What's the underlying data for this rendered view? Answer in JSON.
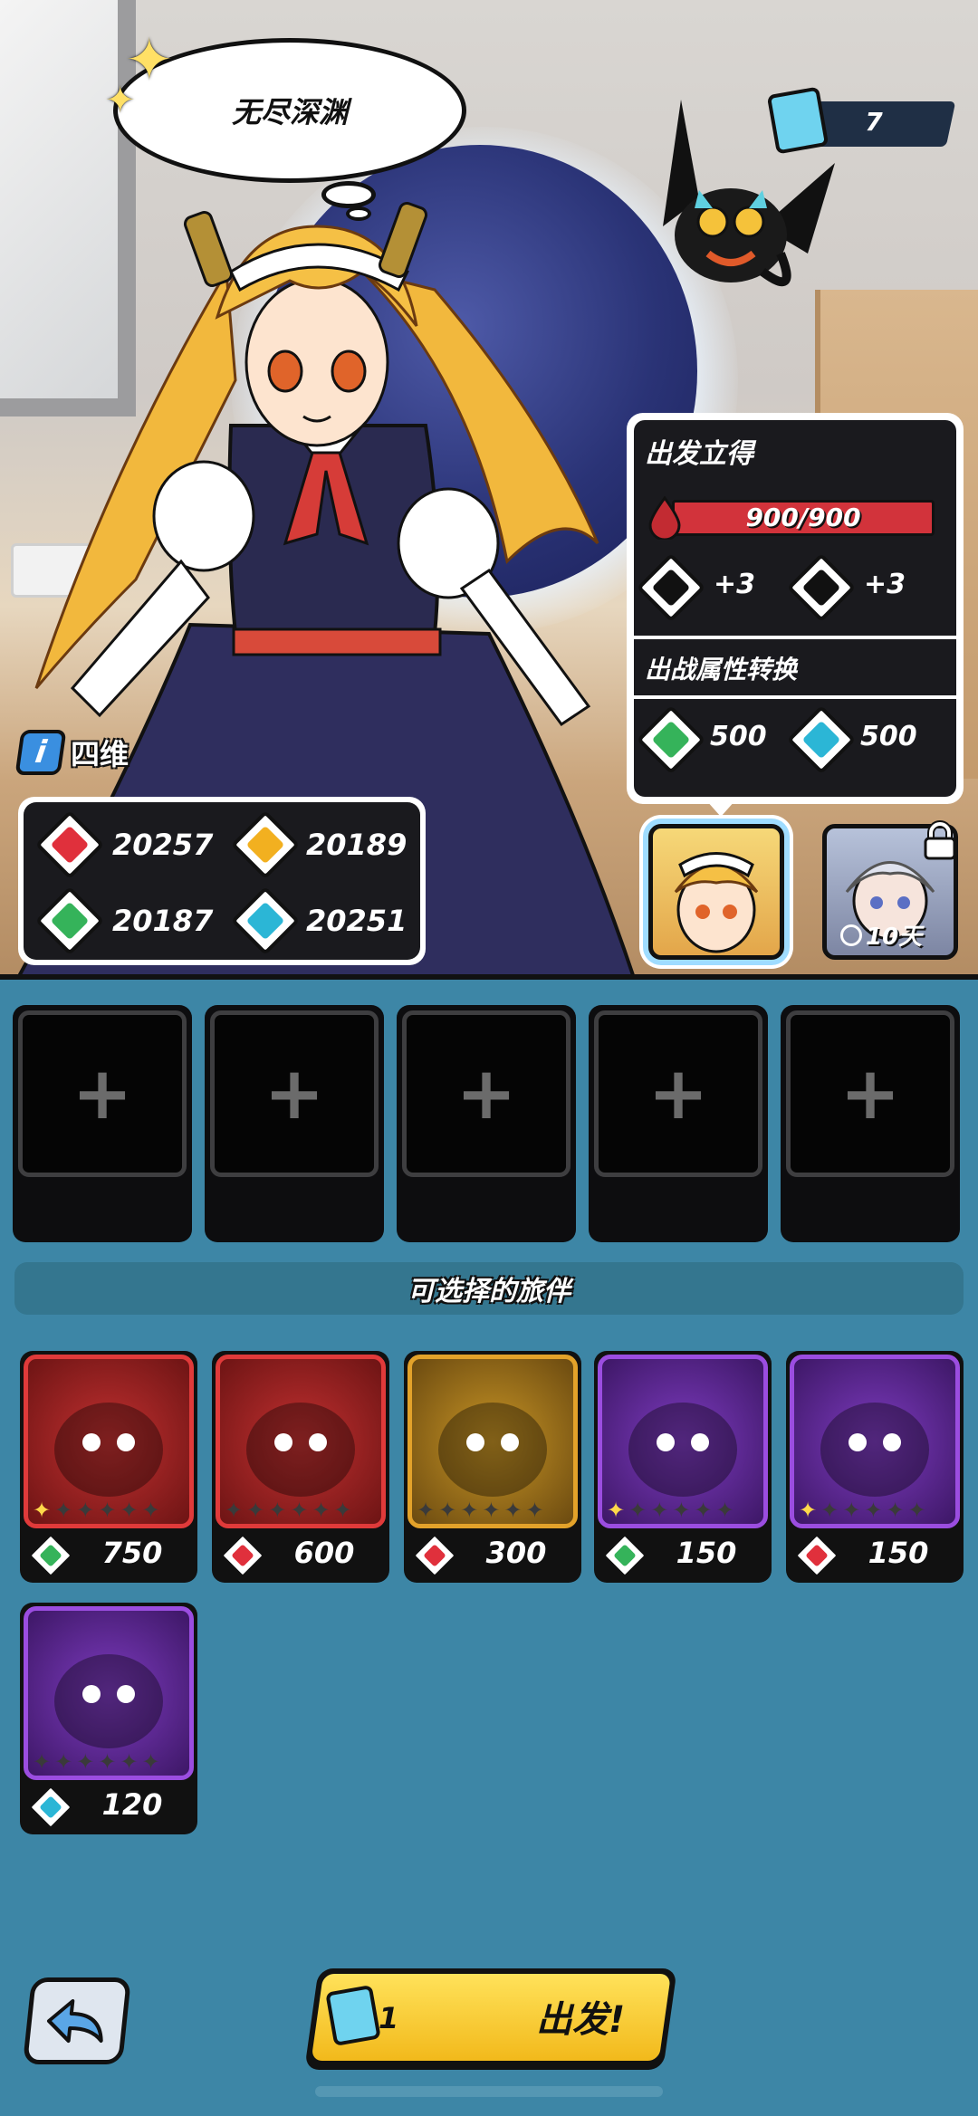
{
  "scene": {
    "bubble_text": "无尽深渊",
    "ticket_count": "7"
  },
  "panel": {
    "title": "出发立得",
    "hp": "900/900",
    "attack_bonus": "+3",
    "defense_bonus": "+3",
    "conversion_title": "出战属性转换",
    "green_value": "500",
    "cyan_value": "500"
  },
  "four_dim": {
    "label": "四维",
    "info_icon": "i",
    "red": "20257",
    "yellow": "20189",
    "green": "20187",
    "cyan": "20251"
  },
  "characters": {
    "locked_timer": "10天"
  },
  "slots": [
    "+",
    "+",
    "+",
    "+",
    "+"
  ],
  "companions_title": "可选择的旅伴",
  "companions": [
    {
      "name": "dark-dragon",
      "value": "750",
      "attr": "green",
      "rarity": "red",
      "stars": 1
    },
    {
      "name": "green-dragon",
      "value": "600",
      "attr": "red",
      "rarity": "red",
      "stars": 0
    },
    {
      "name": "yellow-mask",
      "value": "300",
      "attr": "red",
      "rarity": "gold",
      "stars": 0
    },
    {
      "name": "horn-monster",
      "value": "150",
      "attr": "green",
      "rarity": "purple",
      "stars": 1
    },
    {
      "name": "wolf-beast",
      "value": "150",
      "attr": "red",
      "rarity": "purple",
      "stars": 1
    },
    {
      "name": "slime-eye",
      "value": "120",
      "attr": "cyan",
      "rarity": "purple",
      "stars": 0
    }
  ],
  "bottom": {
    "go_label": "出发!",
    "go_ticket_count": "1"
  },
  "colors": {
    "red_attr": "#e0303c",
    "yellow_attr": "#f2b020",
    "green_attr": "#35b35a",
    "cyan_attr": "#2bb6d6",
    "rarity_red": "#e03a3a",
    "rarity_gold": "#e3a22a",
    "rarity_purple": "#9b4de0",
    "background": "#3d86a6"
  }
}
